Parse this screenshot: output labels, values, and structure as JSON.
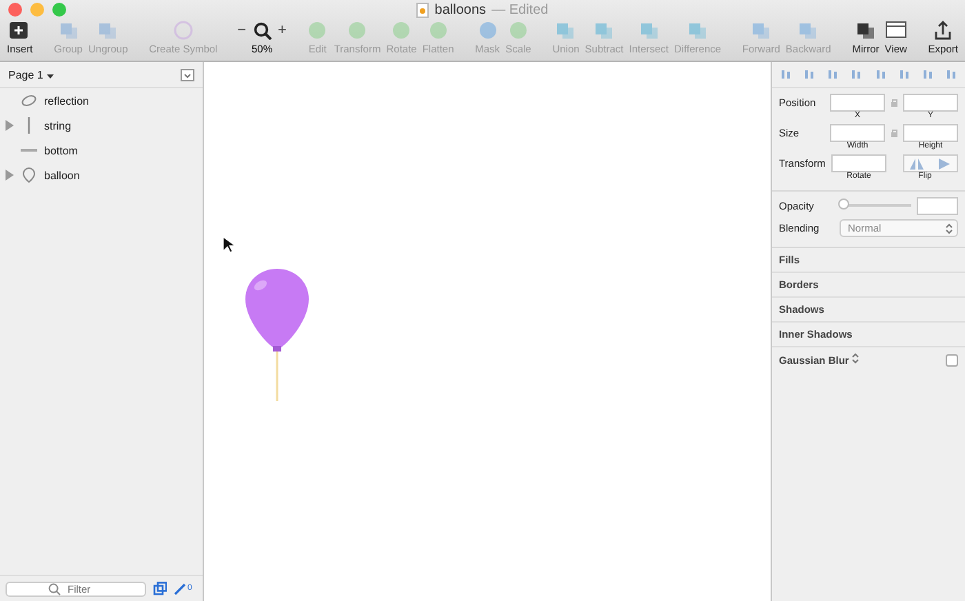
{
  "window": {
    "title": "balloons",
    "subtitle": "— Edited"
  },
  "toolbar": [
    {
      "items": [
        {
          "label": "Insert",
          "disabled": false
        }
      ]
    },
    {
      "items": [
        {
          "label": "Group",
          "disabled": true
        },
        {
          "label": "Ungroup",
          "disabled": true
        }
      ]
    },
    {
      "items": [
        {
          "label": "Create Symbol",
          "disabled": true
        }
      ]
    },
    {
      "zoom": {
        "minus": "−",
        "plus": "+",
        "label": "50%"
      }
    },
    {
      "items": [
        {
          "label": "Edit",
          "disabled": true
        },
        {
          "label": "Transform",
          "disabled": true
        },
        {
          "label": "Rotate",
          "disabled": true
        },
        {
          "label": "Flatten",
          "disabled": true
        }
      ]
    },
    {
      "items": [
        {
          "label": "Mask",
          "disabled": true
        },
        {
          "label": "Scale",
          "disabled": true
        }
      ]
    },
    {
      "items": [
        {
          "label": "Union",
          "disabled": true
        },
        {
          "label": "Subtract",
          "disabled": true
        },
        {
          "label": "Intersect",
          "disabled": true
        },
        {
          "label": "Difference",
          "disabled": true
        }
      ]
    },
    {
      "items": [
        {
          "label": "Forward",
          "disabled": true
        },
        {
          "label": "Backward",
          "disabled": true
        }
      ]
    },
    {
      "items": [
        {
          "label": "Mirror",
          "disabled": false
        },
        {
          "label": "View",
          "disabled": false
        }
      ]
    },
    {
      "items": [
        {
          "label": "Export",
          "disabled": false
        }
      ]
    }
  ],
  "sidebar": {
    "page": "Page 1",
    "layers": [
      {
        "name": "reflection",
        "kind": "oval",
        "group": false
      },
      {
        "name": "string",
        "kind": "line",
        "group": true
      },
      {
        "name": "bottom",
        "kind": "rect",
        "group": false
      },
      {
        "name": "balloon",
        "kind": "balloon",
        "group": true
      }
    ],
    "filter": {
      "placeholder": "Filter"
    },
    "edit_count": "0"
  },
  "inspector": {
    "rows": [
      {
        "label": "Position",
        "fields": [
          "X",
          "Y"
        ]
      },
      {
        "label": "Size",
        "fields": [
          "Width",
          "Height"
        ]
      },
      {
        "label": "Transform",
        "fields": [
          "Rotate"
        ],
        "flip": "Flip"
      }
    ],
    "opacity": {
      "label": "Opacity",
      "level": 0
    },
    "blending": {
      "label": "Blending",
      "value": "Normal"
    },
    "sections": [
      {
        "label": "Fills"
      },
      {
        "label": "Borders"
      },
      {
        "label": "Shadows"
      },
      {
        "label": "Inner Shadows"
      }
    ],
    "blur": {
      "label": "Gaussian Blur",
      "checked": false
    }
  }
}
